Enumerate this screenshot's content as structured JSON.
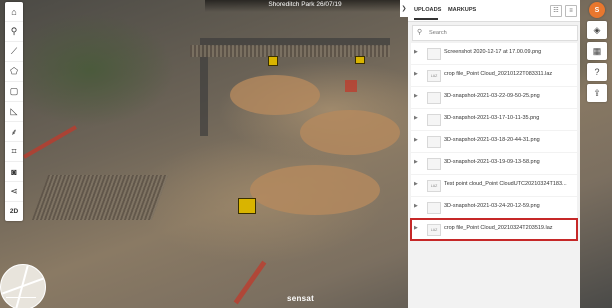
{
  "scene": {
    "title": "Shoreditch Park 26/07/19"
  },
  "left_toolbar": {
    "icons": [
      "home-icon",
      "pin-icon",
      "ruler-icon",
      "area-icon",
      "square-icon",
      "elevation-icon",
      "layers-draw-icon",
      "crop-icon",
      "camera-icon",
      "share-icon"
    ],
    "mode_label": "2D"
  },
  "panel": {
    "toggle_icon": "chevron-right-icon",
    "tabs": [
      {
        "label": "UPLOADS"
      },
      {
        "label": "MARKUPS"
      }
    ],
    "search": {
      "placeholder": "Search",
      "value": ""
    },
    "files": [
      {
        "name": "Screenshot 2020-12-17 at 17.00.09.png",
        "type": "image"
      },
      {
        "name": "crop file_Point Cloud_20210122T083311.laz",
        "type": "laz"
      },
      {
        "name": "3D-snapshot-2021-03-22-09-50-25.png",
        "type": "image"
      },
      {
        "name": "3D-snapshot-2021-03-17-10-11-35.png",
        "type": "image"
      },
      {
        "name": "3D-snapshot-2021-03-18-20-44-31.png",
        "type": "image"
      },
      {
        "name": "3D-snapshot-2021-03-19-09-13-58.png",
        "type": "image"
      },
      {
        "name": "Test point cloud_Point CloudUTC20210324T183...",
        "type": "laz"
      },
      {
        "name": "3D-snapshot-2021-03-24-20-12-59.png",
        "type": "image"
      },
      {
        "name": "crop file_Point Cloud_20210324T203519.laz",
        "type": "laz",
        "selected": true
      }
    ],
    "thumb_label": "LAZ"
  },
  "right_tools": {
    "avatar_initial": "S"
  },
  "brand": "sensat",
  "colors": {
    "highlight": "#c62828",
    "avatar": "#e8772e"
  }
}
